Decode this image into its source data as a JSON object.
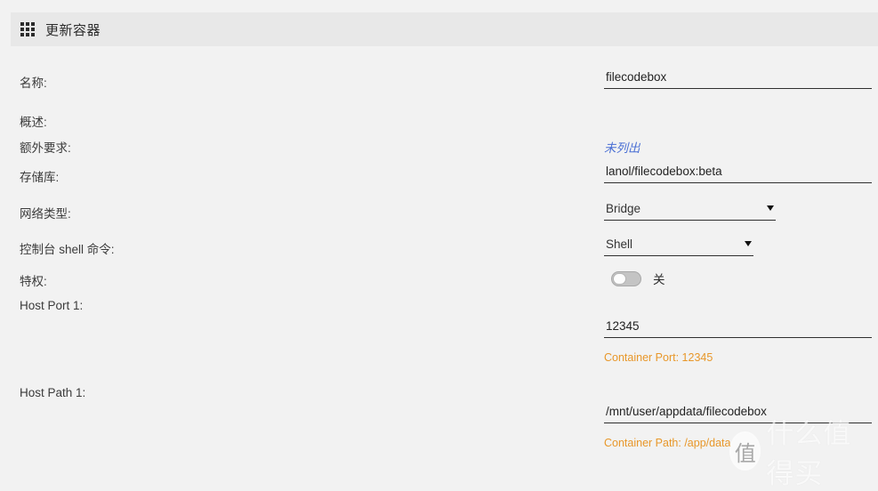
{
  "header": {
    "icon": "grid-apps-icon",
    "title": "更新容器"
  },
  "form": {
    "fields": [
      {
        "label": "名称:",
        "value": "filecodebox",
        "type": "text"
      },
      {
        "label": "概述:",
        "value": "",
        "type": "empty"
      },
      {
        "label": "额外要求:",
        "value": "未列出",
        "type": "link"
      },
      {
        "label": "存储库:",
        "value": "lanol/filecodebox:beta",
        "type": "text"
      },
      {
        "label": "网络类型:",
        "value": "Bridge",
        "type": "select"
      },
      {
        "label": "控制台 shell 命令:",
        "value": "Shell",
        "type": "select"
      },
      {
        "label": "特权:",
        "value": "关",
        "type": "toggle"
      },
      {
        "label": "Host Port 1:",
        "value": "12345",
        "type": "text",
        "hint": "Container Port: 12345"
      },
      {
        "label": "Host Path 1:",
        "value": "/mnt/user/appdata/filecodebox",
        "type": "text",
        "hint": "Container Path: /app/data"
      }
    ]
  },
  "watermark": {
    "logo": "值",
    "text": "什么值得买"
  },
  "colors": {
    "background": "#f2f2f2",
    "header_bg": "#e8e8e8",
    "hint_orange": "#e8972a",
    "link_blue": "#4a6fd4",
    "underline": "#2f2f2f"
  }
}
